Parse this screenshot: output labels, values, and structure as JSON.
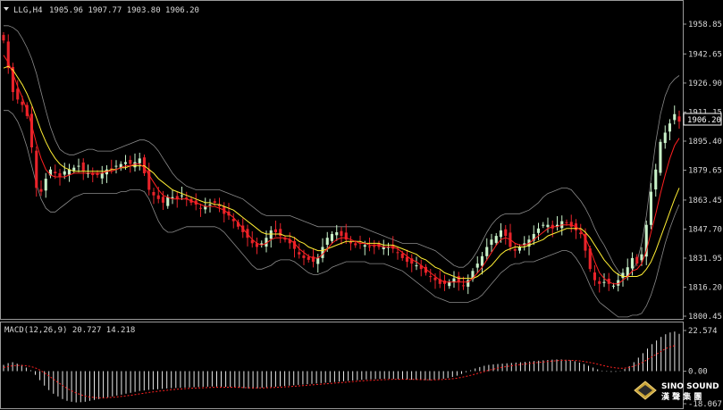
{
  "header": {
    "symbol": "LLG,H4",
    "ohlc": "1905.96 1907.77 1903.80 1906.20"
  },
  "price_axis": {
    "ticks": [
      "1958.85",
      "1942.65",
      "1926.90",
      "1911.15",
      "1895.40",
      "1879.65",
      "1863.45",
      "1847.70",
      "1831.95",
      "1816.20",
      "1800.45"
    ],
    "current_price": "1906.20"
  },
  "macd_panel": {
    "label": "MACD(12,26,9) 20.727 14.218",
    "ticks": [
      "22.574",
      "0.00",
      "-18.067"
    ]
  },
  "logo": {
    "line1": "SINO SOUND",
    "line2": "漢 聲 集 團"
  },
  "colors": {
    "background": "#000000",
    "bull_candle": "#c8f0c8",
    "bear_candle": "#e8232a",
    "ma_fast": "#ff2020",
    "ma_slow": "#ffee33",
    "bollinger": "#8a8a8a",
    "macd_hist": "#e8e8e8",
    "macd_signal": "#ff2020"
  },
  "chart_data": [
    {
      "type": "candlestick",
      "title": "LLG,H4",
      "ylim": [
        1800.45,
        1958.85
      ],
      "yticks": [
        1958.85,
        1942.65,
        1926.9,
        1911.15,
        1895.4,
        1879.65,
        1863.45,
        1847.7,
        1831.95,
        1816.2,
        1800.45
      ],
      "last_price": 1906.2,
      "close": [
        1950,
        1935,
        1922,
        1918,
        1915,
        1909,
        1892,
        1870,
        1868,
        1875,
        1880,
        1878,
        1876,
        1879,
        1880,
        1881,
        1882,
        1879,
        1878,
        1877,
        1877,
        1878,
        1880,
        1880,
        1882,
        1883,
        1884,
        1883,
        1884,
        1886,
        1878,
        1869,
        1866,
        1864,
        1862,
        1865,
        1865,
        1864,
        1866,
        1864,
        1862,
        1861,
        1859,
        1860,
        1861,
        1862,
        1860,
        1856,
        1855,
        1852,
        1849,
        1846,
        1843,
        1840,
        1838,
        1840,
        1843,
        1847,
        1846,
        1844,
        1842,
        1840,
        1837,
        1834,
        1832,
        1831,
        1830,
        1832,
        1838,
        1843,
        1845,
        1846,
        1844,
        1842,
        1840,
        1839,
        1840,
        1839,
        1838,
        1838,
        1838,
        1838,
        1838,
        1837,
        1835,
        1832,
        1830,
        1829,
        1828,
        1826,
        1824,
        1822,
        1820,
        1818,
        1818,
        1819,
        1821,
        1819,
        1817,
        1820,
        1825,
        1829,
        1833,
        1838,
        1842,
        1844,
        1847,
        1844,
        1838,
        1836,
        1838,
        1840,
        1842,
        1845,
        1848,
        1850,
        1850,
        1848,
        1850,
        1852,
        1851,
        1849,
        1847,
        1845,
        1836,
        1826,
        1820,
        1818,
        1819,
        1818,
        1817,
        1820,
        1824,
        1827,
        1832,
        1829,
        1834,
        1850,
        1868,
        1880,
        1895,
        1900,
        1905,
        1910,
        1906
      ],
      "ma_fast": [
        1942,
        1938,
        1932,
        1925,
        1919,
        1912,
        1904,
        1894,
        1886,
        1880,
        1877,
        1876,
        1876,
        1876,
        1877,
        1878,
        1878,
        1878,
        1878,
        1878,
        1878,
        1878,
        1879,
        1879,
        1880,
        1881,
        1882,
        1882,
        1883,
        1883,
        1881,
        1877,
        1873,
        1869,
        1866,
        1865,
        1864,
        1864,
        1864,
        1864,
        1863,
        1862,
        1861,
        1860,
        1860,
        1860,
        1859,
        1858,
        1856,
        1854,
        1851,
        1848,
        1845,
        1842,
        1840,
        1839,
        1840,
        1842,
        1843,
        1843,
        1843,
        1842,
        1840,
        1837,
        1835,
        1833,
        1832,
        1832,
        1834,
        1837,
        1840,
        1842,
        1843,
        1843,
        1842,
        1841,
        1840,
        1840,
        1839,
        1839,
        1839,
        1838,
        1838,
        1838,
        1837,
        1835,
        1833,
        1831,
        1830,
        1828,
        1826,
        1824,
        1822,
        1820,
        1819,
        1819,
        1819,
        1819,
        1819,
        1819,
        1821,
        1824,
        1827,
        1831,
        1835,
        1839,
        1842,
        1843,
        1842,
        1840,
        1839,
        1839,
        1840,
        1842,
        1844,
        1846,
        1848,
        1849,
        1849,
        1850,
        1850,
        1850,
        1849,
        1847,
        1843,
        1837,
        1830,
        1824,
        1821,
        1819,
        1818,
        1818,
        1820,
        1822,
        1825,
        1826,
        1829,
        1836,
        1846,
        1856,
        1867,
        1877,
        1886,
        1893,
        1897
      ],
      "ma_slow": [
        1935,
        1936,
        1934,
        1930,
        1926,
        1921,
        1915,
        1908,
        1901,
        1895,
        1890,
        1886,
        1883,
        1881,
        1880,
        1879,
        1879,
        1879,
        1879,
        1879,
        1879,
        1879,
        1879,
        1880,
        1880,
        1881,
        1881,
        1882,
        1882,
        1882,
        1882,
        1880,
        1878,
        1875,
        1873,
        1871,
        1869,
        1868,
        1867,
        1866,
        1865,
        1864,
        1863,
        1862,
        1862,
        1861,
        1861,
        1860,
        1859,
        1858,
        1856,
        1854,
        1852,
        1850,
        1848,
        1846,
        1845,
        1845,
        1845,
        1845,
        1844,
        1844,
        1843,
        1841,
        1840,
        1838,
        1837,
        1836,
        1836,
        1837,
        1838,
        1839,
        1840,
        1841,
        1841,
        1841,
        1841,
        1840,
        1840,
        1840,
        1840,
        1839,
        1839,
        1839,
        1838,
        1837,
        1836,
        1835,
        1834,
        1832,
        1831,
        1829,
        1827,
        1826,
        1824,
        1823,
        1822,
        1821,
        1821,
        1821,
        1821,
        1822,
        1824,
        1826,
        1828,
        1831,
        1834,
        1836,
        1837,
        1838,
        1838,
        1838,
        1839,
        1840,
        1841,
        1842,
        1844,
        1845,
        1846,
        1847,
        1848,
        1848,
        1848,
        1848,
        1846,
        1843,
        1839,
        1835,
        1831,
        1828,
        1825,
        1823,
        1822,
        1822,
        1822,
        1822,
        1823,
        1826,
        1830,
        1836,
        1843,
        1850,
        1857,
        1864,
        1870
      ],
      "bb_upper": [
        1958,
        1958,
        1957,
        1955,
        1951,
        1946,
        1940,
        1932,
        1922,
        1912,
        1903,
        1896,
        1891,
        1889,
        1888,
        1888,
        1889,
        1890,
        1891,
        1891,
        1890,
        1890,
        1890,
        1890,
        1891,
        1892,
        1893,
        1894,
        1895,
        1896,
        1896,
        1895,
        1893,
        1890,
        1886,
        1882,
        1878,
        1875,
        1873,
        1871,
        1870,
        1869,
        1869,
        1869,
        1869,
        1869,
        1869,
        1868,
        1867,
        1866,
        1865,
        1864,
        1862,
        1860,
        1858,
        1856,
        1855,
        1855,
        1855,
        1855,
        1855,
        1855,
        1854,
        1853,
        1852,
        1851,
        1850,
        1849,
        1849,
        1849,
        1849,
        1849,
        1849,
        1849,
        1849,
        1849,
        1849,
        1848,
        1847,
        1846,
        1845,
        1844,
        1843,
        1842,
        1841,
        1840,
        1840,
        1840,
        1840,
        1839,
        1838,
        1837,
        1836,
        1834,
        1832,
        1830,
        1828,
        1827,
        1827,
        1829,
        1832,
        1836,
        1841,
        1846,
        1850,
        1853,
        1855,
        1856,
        1856,
        1856,
        1856,
        1857,
        1858,
        1860,
        1862,
        1865,
        1867,
        1868,
        1869,
        1870,
        1870,
        1869,
        1866,
        1863,
        1859,
        1854,
        1848,
        1843,
        1839,
        1834,
        1829,
        1825,
        1822,
        1822,
        1825,
        1830,
        1840,
        1855,
        1875,
        1895,
        1910,
        1920,
        1926,
        1929,
        1931
      ],
      "bb_lower": [
        1912,
        1912,
        1910,
        1906,
        1900,
        1892,
        1882,
        1872,
        1864,
        1859,
        1857,
        1857,
        1859,
        1861,
        1863,
        1865,
        1866,
        1867,
        1867,
        1867,
        1867,
        1867,
        1867,
        1867,
        1867,
        1868,
        1868,
        1869,
        1869,
        1869,
        1868,
        1864,
        1858,
        1852,
        1848,
        1846,
        1846,
        1847,
        1848,
        1849,
        1849,
        1849,
        1849,
        1849,
        1849,
        1849,
        1848,
        1846,
        1843,
        1840,
        1837,
        1834,
        1831,
        1828,
        1826,
        1826,
        1827,
        1828,
        1830,
        1831,
        1831,
        1831,
        1830,
        1828,
        1826,
        1824,
        1823,
        1823,
        1824,
        1825,
        1827,
        1828,
        1829,
        1830,
        1830,
        1830,
        1830,
        1830,
        1829,
        1829,
        1829,
        1829,
        1828,
        1827,
        1826,
        1825,
        1823,
        1821,
        1819,
        1817,
        1815,
        1813,
        1811,
        1810,
        1809,
        1808,
        1808,
        1808,
        1808,
        1808,
        1809,
        1810,
        1812,
        1815,
        1818,
        1821,
        1824,
        1826,
        1828,
        1829,
        1829,
        1830,
        1830,
        1830,
        1831,
        1832,
        1833,
        1834,
        1835,
        1836,
        1836,
        1835,
        1832,
        1828,
        1823,
        1817,
        1812,
        1808,
        1806,
        1804,
        1802,
        1800,
        1800,
        1800,
        1801,
        1801,
        1802,
        1806,
        1812,
        1820,
        1830,
        1840,
        1848,
        1855,
        1861
      ]
    },
    {
      "type": "bar",
      "title": "MACD(12,26,9) 20.727 14.218",
      "ylim": [
        -18.067,
        22.574
      ],
      "yticks": [
        22.574,
        0.0,
        -18.067
      ],
      "series": [
        {
          "name": "MACD",
          "values": [
            3.5,
            4.5,
            5.0,
            4.2,
            3.5,
            2.0,
            0.5,
            -2.0,
            -5.0,
            -8.0,
            -10.5,
            -12.5,
            -14.0,
            -15.5,
            -16.5,
            -17.0,
            -17.3,
            -17.2,
            -17.0,
            -16.5,
            -16.0,
            -15.5,
            -15.0,
            -14.5,
            -14.0,
            -13.5,
            -13.0,
            -12.5,
            -12.0,
            -11.5,
            -11.0,
            -10.7,
            -10.4,
            -10.2,
            -10.0,
            -9.8,
            -9.6,
            -9.4,
            -9.3,
            -9.2,
            -9.1,
            -9.0,
            -8.9,
            -8.8,
            -8.7,
            -8.6,
            -8.5,
            -8.5,
            -8.6,
            -8.7,
            -8.8,
            -9.0,
            -9.2,
            -9.4,
            -9.6,
            -9.7,
            -9.5,
            -9.2,
            -9.0,
            -8.8,
            -8.6,
            -8.4,
            -8.2,
            -8.0,
            -7.8,
            -7.6,
            -7.4,
            -7.2,
            -7.0,
            -6.8,
            -6.6,
            -6.4,
            -6.2,
            -6.0,
            -5.8,
            -5.6,
            -5.4,
            -5.2,
            -5.0,
            -4.8,
            -4.6,
            -4.5,
            -4.4,
            -4.3,
            -4.2,
            -4.2,
            -4.3,
            -4.4,
            -4.5,
            -4.6,
            -4.7,
            -4.8,
            -4.9,
            -5.0,
            -5.0,
            -4.8,
            -4.5,
            -4.2,
            -3.8,
            -3.2,
            -2.5,
            -1.5,
            -0.5,
            0.5,
            1.5,
            2.3,
            3.0,
            3.5,
            3.8,
            4.0,
            4.2,
            4.4,
            4.6,
            4.8,
            5.0,
            5.2,
            5.4,
            5.6,
            5.8,
            6.0,
            6.2,
            6.4,
            6.5,
            6.5,
            6.3,
            6.0,
            5.5,
            4.8,
            4.0,
            3.0,
            2.0,
            1.0,
            0.3,
            -0.2,
            -0.4,
            -0.3,
            0.2,
            1.2,
            2.8,
            5.0,
            7.5,
            10.0,
            12.5,
            15.0,
            17.0,
            19.0,
            20.5,
            21.5,
            22.0,
            20.727
          ]
        },
        {
          "name": "Signal",
          "values": [
            2.0,
            2.6,
            3.0,
            3.2,
            3.2,
            3.0,
            2.6,
            1.8,
            0.6,
            -0.9,
            -2.6,
            -4.4,
            -6.2,
            -7.9,
            -9.5,
            -10.9,
            -12.1,
            -13.0,
            -13.8,
            -14.3,
            -14.6,
            -14.8,
            -14.8,
            -14.7,
            -14.5,
            -14.3,
            -14.0,
            -13.7,
            -13.4,
            -13.0,
            -12.6,
            -12.2,
            -11.8,
            -11.5,
            -11.2,
            -10.9,
            -10.6,
            -10.3,
            -10.1,
            -9.9,
            -9.7,
            -9.5,
            -9.4,
            -9.3,
            -9.2,
            -9.1,
            -9.0,
            -8.9,
            -8.9,
            -8.9,
            -8.9,
            -8.9,
            -9.0,
            -9.1,
            -9.2,
            -9.3,
            -9.3,
            -9.3,
            -9.2,
            -9.1,
            -9.0,
            -8.9,
            -8.7,
            -8.6,
            -8.4,
            -8.2,
            -8.0,
            -7.8,
            -7.6,
            -7.4,
            -7.2,
            -7.0,
            -6.8,
            -6.6,
            -6.4,
            -6.2,
            -6.0,
            -5.8,
            -5.6,
            -5.4,
            -5.2,
            -5.1,
            -5.0,
            -4.8,
            -4.7,
            -4.6,
            -4.5,
            -4.5,
            -4.5,
            -4.5,
            -4.6,
            -4.6,
            -4.7,
            -4.7,
            -4.8,
            -4.8,
            -4.7,
            -4.6,
            -4.4,
            -4.2,
            -3.9,
            -3.4,
            -2.9,
            -2.3,
            -1.6,
            -0.9,
            -0.2,
            0.5,
            1.1,
            1.7,
            2.2,
            2.6,
            3.0,
            3.4,
            3.7,
            4.0,
            4.3,
            4.6,
            4.9,
            5.1,
            5.4,
            5.6,
            5.8,
            6.0,
            6.0,
            6.0,
            5.9,
            5.7,
            5.4,
            5.0,
            4.5,
            3.9,
            3.3,
            2.7,
            2.2,
            1.8,
            1.6,
            1.7,
            2.1,
            2.8,
            3.8,
            5.0,
            6.5,
            8.0,
            9.5,
            11.0,
            12.5,
            13.5,
            14.218
          ]
        }
      ]
    }
  ]
}
